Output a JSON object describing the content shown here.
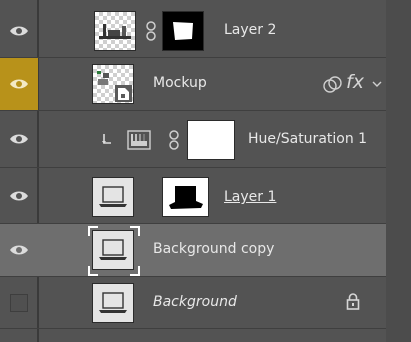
{
  "layers": [
    {
      "name": "Layer 2",
      "visible": true
    },
    {
      "name": "Mockup",
      "visible": true,
      "fx_label": "fx"
    },
    {
      "name": "Hue/Saturation 1",
      "visible": true
    },
    {
      "name": "Layer 1",
      "visible": true
    },
    {
      "name": "Background copy",
      "visible": true,
      "selected": true
    },
    {
      "name": "Background",
      "visible": false,
      "locked": true
    }
  ],
  "colors": {
    "panel_bg": "#535353",
    "selected_row": "#6e6e6e",
    "smart_object_highlight": "#b8921a"
  }
}
